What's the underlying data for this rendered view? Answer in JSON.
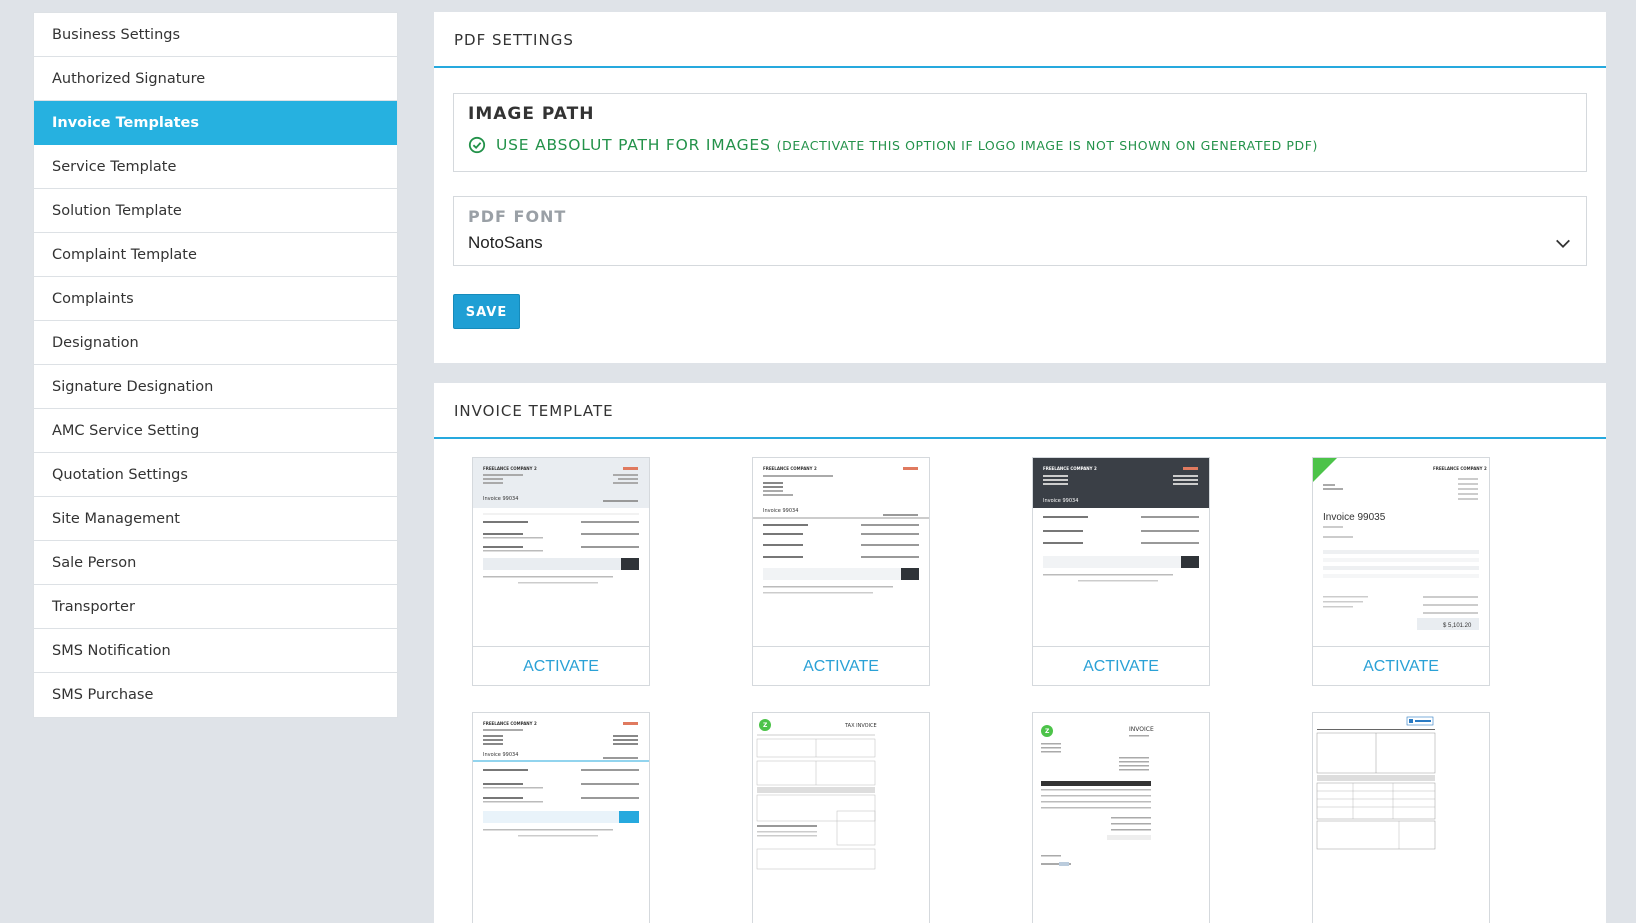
{
  "sidebar": {
    "items": [
      {
        "label": "Business Settings"
      },
      {
        "label": "Authorized Signature"
      },
      {
        "label": "Invoice Templates",
        "active": true
      },
      {
        "label": "Service Template"
      },
      {
        "label": "Solution Template"
      },
      {
        "label": "Complaint Template"
      },
      {
        "label": "Complaints"
      },
      {
        "label": "Designation"
      },
      {
        "label": "Signature Designation"
      },
      {
        "label": "AMC Service Setting"
      },
      {
        "label": "Quotation Settings"
      },
      {
        "label": "Site Management"
      },
      {
        "label": "Sale Person"
      },
      {
        "label": "Transporter"
      },
      {
        "label": "SMS Notification"
      },
      {
        "label": "SMS Purchase"
      }
    ]
  },
  "pdf_settings": {
    "title": "PDF SETTINGS",
    "image_path": {
      "title": "IMAGE PATH",
      "option_label": "USE ABSOLUT PATH FOR IMAGES",
      "option_note": "(DEACTIVATE THIS OPTION IF LOGO IMAGE IS NOT SHOWN ON GENERATED PDF)",
      "checked": true
    },
    "pdf_font": {
      "label": "PDF FONT",
      "value": "NotoSans"
    },
    "save_label": "SAVE"
  },
  "invoice_template": {
    "title": "INVOICE TEMPLATE",
    "activate_label": "ACTIVATE",
    "thumb_texts": {
      "company": "FREELANCE COMPANY 2",
      "invoice_no": "Invoice 99034",
      "invoice_alt": "Invoice 99035",
      "total": "$ 5,101.20",
      "tax_invoice": "TAX INVOICE",
      "invoice_caps": "INVOICE"
    }
  },
  "colors": {
    "accent": "#26b1e0",
    "success": "#23924a",
    "dark_header": "#3a3f46",
    "muted": "#9aa0a6"
  }
}
